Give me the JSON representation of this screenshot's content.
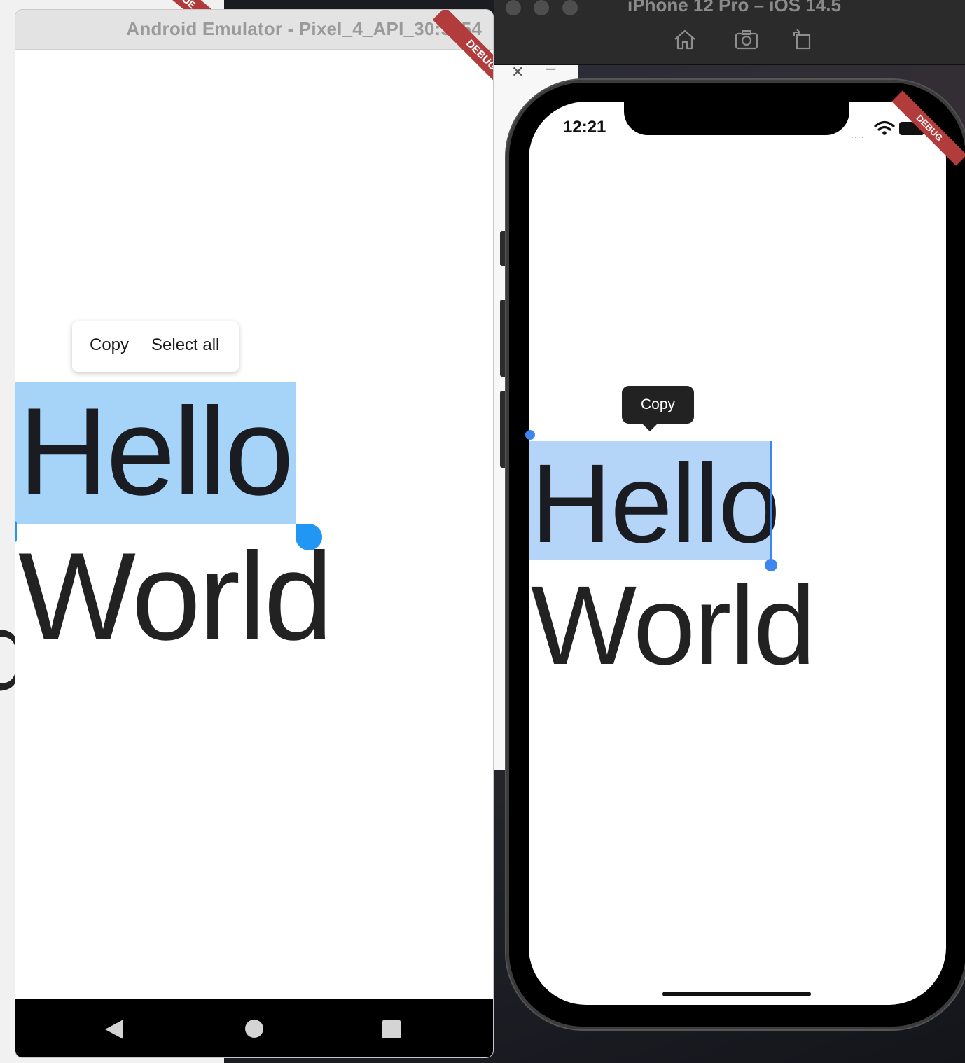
{
  "android": {
    "window_title": "Android Emulator - Pixel_4_API_30:5554",
    "debug_banner": "DEBUG",
    "context_menu": {
      "copy": "Copy",
      "select_all": "Select all"
    },
    "text_line1": "Hello",
    "text_line2": "World"
  },
  "background": {
    "peek_banner": "DE",
    "peek_glyph": "d"
  },
  "ios": {
    "window_title": "iPhone 12 Pro – iOS 14.5",
    "status_time": "12:21",
    "status_signal": "....",
    "debug_banner": "DEBUG",
    "context_menu": {
      "copy": "Copy"
    },
    "text_line1": "Hello",
    "text_line2": "World",
    "panel_close": "✕",
    "panel_min": "–"
  },
  "colors": {
    "selection_android": "#a5d4f8",
    "selection_ios": "#b4d5f7",
    "handle": "#2196f3",
    "debug_ribbon": "#b23b3b"
  },
  "icons": [
    "home-icon",
    "screenshot-icon",
    "rotate-icon",
    "back-icon",
    "home-circle-icon",
    "recents-icon",
    "wifi-icon",
    "battery-icon"
  ]
}
